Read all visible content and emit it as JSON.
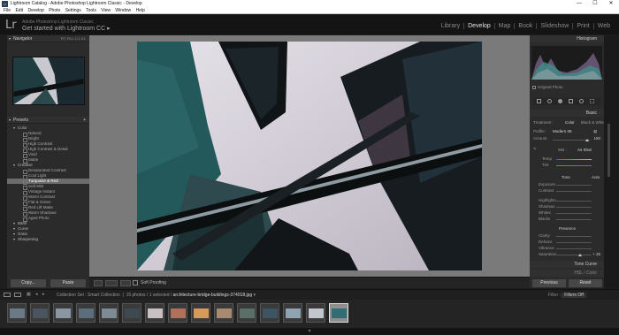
{
  "window": {
    "title": "Lightroom Catalog - Adobe Photoshop Lightroom Classic - Develop",
    "minimize": "—",
    "maximize": "☐",
    "close": "✕"
  },
  "menu": [
    "File",
    "Edit",
    "Develop",
    "Photo",
    "Settings",
    "Tools",
    "View",
    "Window",
    "Help"
  ],
  "identity": {
    "logo": "Lr",
    "catalog": "Adobe Photoshop Lightroom Classic",
    "subtitle": "Get started with Lightroom CC ▸"
  },
  "modules": [
    "Library",
    "Develop",
    "Map",
    "Book",
    "Slideshow",
    "Print",
    "Web"
  ],
  "active_module": "Develop",
  "left": {
    "navigator_title": "Navigator",
    "zoom_options": [
      "FIT",
      "FILL",
      "1:1",
      "3:1"
    ],
    "presets_title": "Presets",
    "presets": [
      {
        "label": "Color",
        "folder": true
      },
      {
        "label": "Natural"
      },
      {
        "label": "Bright"
      },
      {
        "label": "High Contrast"
      },
      {
        "label": "High Contrast & Detail"
      },
      {
        "label": "Vivid"
      },
      {
        "label": "Matte"
      },
      {
        "label": "Creative",
        "folder": true
      },
      {
        "label": "Desaturated Contrast"
      },
      {
        "label": "Cool Light"
      },
      {
        "label": "Turquoise & Red",
        "selected": true
      },
      {
        "label": "Soft Mist"
      },
      {
        "label": "Vintage Instant"
      },
      {
        "label": "Warm Contrast"
      },
      {
        "label": "Flat & Green"
      },
      {
        "label": "Red Lift Matte"
      },
      {
        "label": "Warm Shadows"
      },
      {
        "label": "Aged Photo"
      },
      {
        "label": "B&W",
        "folder": true
      },
      {
        "label": "Curve",
        "folder": true
      },
      {
        "label": "Grain",
        "folder": true
      },
      {
        "label": "Sharpening",
        "folder": true
      }
    ],
    "copy_label": "Copy...",
    "paste_label": "Paste"
  },
  "toolbar": {
    "soft_proofing": "Soft Proofing"
  },
  "right": {
    "histogram_title": "Histogram",
    "original_photo": "Original Photo",
    "basic_title": "Basic",
    "treatment_label": "Treatment :",
    "treatment_color": "Color",
    "treatment_bw": "Black & White",
    "profile_label": "Profile :",
    "profile_value": "Modern 06",
    "amount_label": "Amount",
    "amount_value": "150",
    "wb_label": "WB :",
    "wb_value": "As Shot",
    "temp_label": "Temp",
    "tint_label": "Tint",
    "tone_label": "Tone",
    "auto_label": "Auto",
    "exposure_label": "Exposure",
    "contrast_label": "Contrast",
    "highlights_label": "Highlights",
    "shadows_label": "Shadows",
    "whites_label": "Whites",
    "blacks_label": "Blacks",
    "presence_label": "Presence",
    "clarity_label": "Clarity",
    "dehaze_label": "Dehaze",
    "vibrance_label": "Vibrance",
    "saturation_label": "Saturation",
    "saturation_value": "+ 25",
    "tone_curve_title": "Tone Curve",
    "hsl_title": "HSL / Color",
    "previous_label": "Previous",
    "reset_label": "Reset"
  },
  "filmstrip": {
    "pages": "1  2",
    "source": "Collection Set : Smart Collection",
    "count": "15 photos / 1 selected /",
    "filename": "architecture-bridge-buildings-374018.jpg",
    "filter_label": "Filter :",
    "filter_value": "Filters Off",
    "thumb_colors": [
      "#6b7a86",
      "#4a5560",
      "#8a97a3",
      "#5c6d7c",
      "#7e8b95",
      "#3f4952",
      "#c9c0c4",
      "#b0705a",
      "#d79a58",
      "#a88a70",
      "#5a6f66",
      "#3e5462",
      "#8fa4b0",
      "#c1c7cc",
      "#2f6f73"
    ],
    "selected_index": 14
  },
  "colors": {
    "accent": "#e6e6e6",
    "selected_preset": "#6c6c6c",
    "photo_teal": "#2f6f73",
    "photo_sky": "#d7d3db"
  }
}
